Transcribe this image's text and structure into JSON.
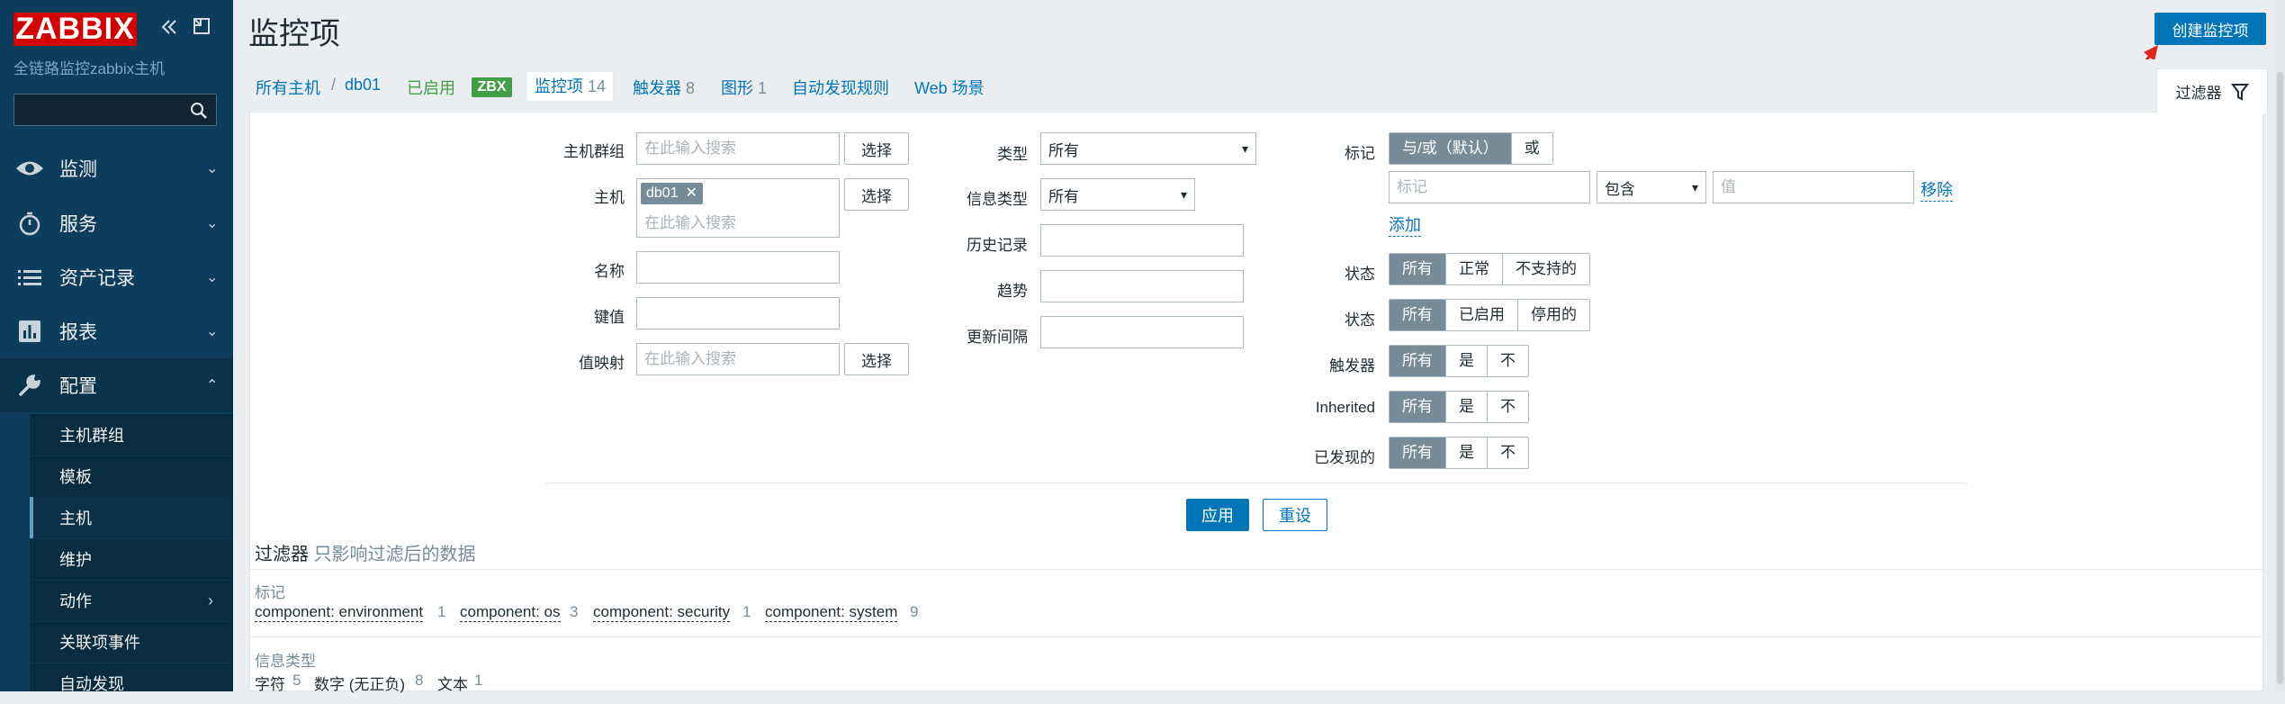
{
  "sidebar": {
    "logo": "ZABBIX",
    "server_name": "全链路监控zabbix主机",
    "search_placeholder": "",
    "menu": [
      {
        "label": "监测",
        "icon": "eye-icon"
      },
      {
        "label": "服务",
        "icon": "stopwatch-icon"
      },
      {
        "label": "资产记录",
        "icon": "list-icon"
      },
      {
        "label": "报表",
        "icon": "bar-chart-icon"
      },
      {
        "label": "配置",
        "icon": "wrench-icon"
      }
    ],
    "submenu": [
      {
        "label": "主机群组"
      },
      {
        "label": "模板"
      },
      {
        "label": "主机"
      },
      {
        "label": "维护"
      },
      {
        "label": "动作"
      },
      {
        "label": "关联项事件"
      },
      {
        "label": "自动发现"
      }
    ]
  },
  "header": {
    "title": "监控项",
    "create_button": "创建监控项"
  },
  "breadcrumb": {
    "all_hosts": "所有主机",
    "sep": "/",
    "host": "db01",
    "status": "已启用",
    "badge": "ZBX",
    "tabs": [
      {
        "label": "监控项",
        "count": "14"
      },
      {
        "label": "触发器",
        "count": "8"
      },
      {
        "label": "图形",
        "count": "1"
      },
      {
        "label": "自动发现规则",
        "count": ""
      },
      {
        "label": "Web 场景",
        "count": ""
      }
    ]
  },
  "filter": {
    "tab_label": "过滤器",
    "host_group_label": "主机群组",
    "host_group_placeholder": "在此输入搜索",
    "select_label": "选择",
    "host_label": "主机",
    "host_chip": "db01",
    "host_placeholder": "在此输入搜索",
    "name_label": "名称",
    "key_label": "键值",
    "valuemap_label": "值映射",
    "valuemap_placeholder": "在此输入搜索",
    "type_label": "类型",
    "type_value": "所有",
    "info_type_label": "信息类型",
    "info_type_value": "所有",
    "history_label": "历史记录",
    "trends_label": "趋势",
    "interval_label": "更新间隔",
    "tags_label": "标记",
    "tags_ops": [
      "与/或（默认）",
      "或"
    ],
    "tag_placeholder": "标记",
    "tag_operator": "包含",
    "tag_value_placeholder": "值",
    "remove_label": "移除",
    "add_label": "添加",
    "state_label": "状态",
    "state_opts": [
      "所有",
      "正常",
      "不支持的"
    ],
    "status_label": "状态",
    "status_opts": [
      "所有",
      "已启用",
      "停用的"
    ],
    "triggers_label": "触发器",
    "triggers_opts": [
      "所有",
      "是",
      "不"
    ],
    "inherited_label": "Inherited",
    "inherited_opts": [
      "所有",
      "是",
      "不"
    ],
    "discovered_label": "已发现的",
    "discovered_opts": [
      "所有",
      "是",
      "不"
    ],
    "apply": "应用",
    "reset": "重设"
  },
  "subfilter": {
    "title": "过滤器",
    "hint": "只影响过滤后的数据",
    "tags_head": "标记",
    "tags": [
      {
        "label": "component: environment",
        "count": "1"
      },
      {
        "label": "component: os",
        "count": "3"
      },
      {
        "label": "component: security",
        "count": "1"
      },
      {
        "label": "component: system",
        "count": "9"
      }
    ],
    "info_head": "信息类型",
    "info": [
      {
        "label": "字符",
        "count": "5"
      },
      {
        "label": "数字 (无正负)",
        "count": "8"
      },
      {
        "label": "文本",
        "count": "1"
      }
    ]
  },
  "colors": {
    "sidebar_bg": "#0c3d5a",
    "logo_red": "#d40000",
    "primary_blue": "#0275b8",
    "enabled_green": "#429e47",
    "segment_on": "#768d99",
    "annotation_arrow": "#e0261c"
  }
}
